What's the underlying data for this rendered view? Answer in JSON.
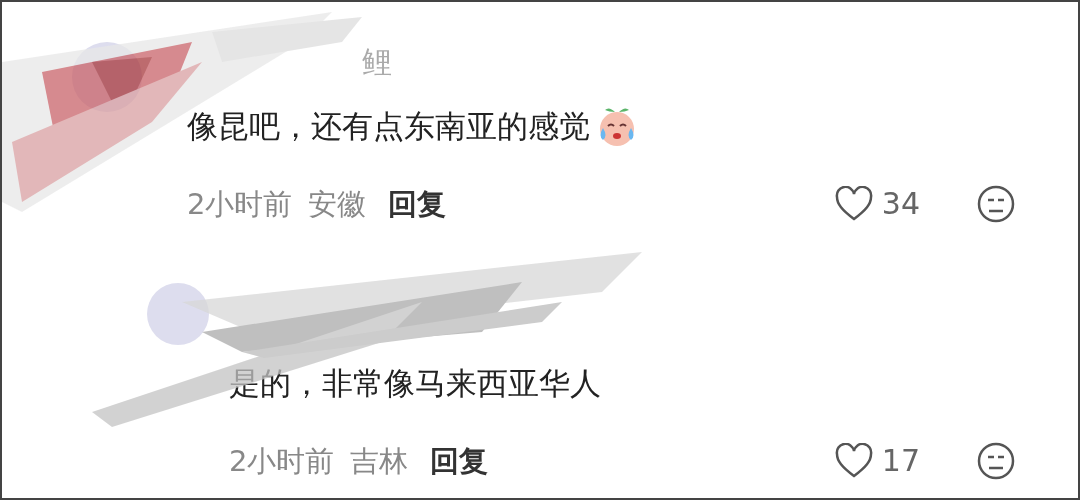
{
  "comments": [
    {
      "username": "鲤",
      "text": "像昆吧，还有点东南亚的感觉",
      "emoji": true,
      "time": "2小时前",
      "location": "安徽",
      "reply_label": "回复",
      "likes": "34",
      "liked": false,
      "children": [
        {
          "text": "是的，非常像马来西亚华人",
          "emoji": false,
          "time": "2小时前",
          "location": "吉林",
          "reply_label": "回复",
          "likes": "17",
          "liked": false
        }
      ]
    }
  ]
}
